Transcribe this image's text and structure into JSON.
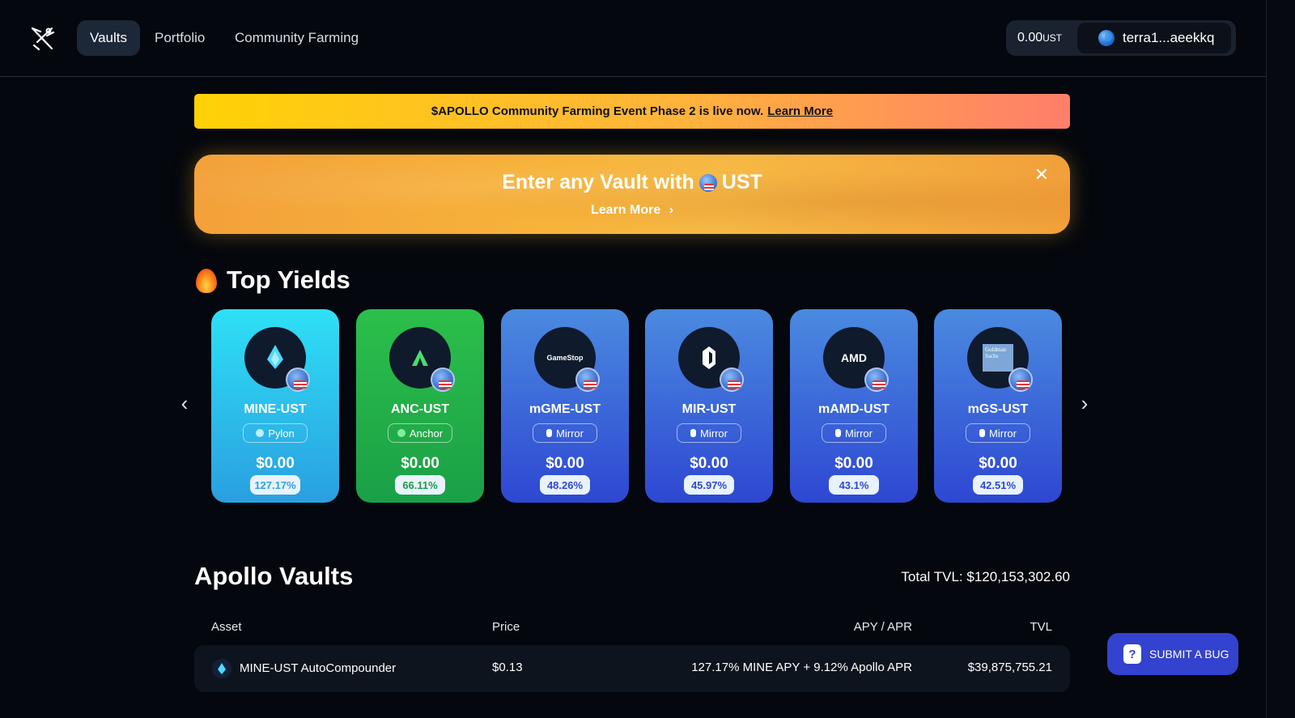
{
  "nav": {
    "items": [
      {
        "label": "Vaults"
      },
      {
        "label": "Portfolio"
      },
      {
        "label": "Community Farming"
      }
    ],
    "balance_value": "0.00",
    "balance_unit": "UST",
    "wallet_address": "terra1...aeekkq"
  },
  "notice": {
    "text": "$APOLLO Community Farming Event Phase 2 is live now.",
    "link": "Learn More"
  },
  "promo": {
    "title_before": "Enter any Vault with",
    "title_after": "UST",
    "link": "Learn More",
    "close_glyph": "✕"
  },
  "top_yields": {
    "title": "Top Yields",
    "prev_glyph": "‹",
    "next_glyph": "›",
    "cards": [
      {
        "name": "MINE-UST",
        "protocol": "Pylon",
        "price": "$0.00",
        "apy": "127.17%"
      },
      {
        "name": "ANC-UST",
        "protocol": "Anchor",
        "price": "$0.00",
        "apy": "66.11%"
      },
      {
        "name": "mGME-UST",
        "protocol": "Mirror",
        "price": "$0.00",
        "apy": "48.26%",
        "logo_text": "GameStop"
      },
      {
        "name": "MIR-UST",
        "protocol": "Mirror",
        "price": "$0.00",
        "apy": "45.97%"
      },
      {
        "name": "mAMD-UST",
        "protocol": "Mirror",
        "price": "$0.00",
        "apy": "43.1%",
        "logo_text": "AMD"
      },
      {
        "name": "mGS-UST",
        "protocol": "Mirror",
        "price": "$0.00",
        "apy": "42.51%",
        "logo_text": "Goldman Sachs"
      }
    ]
  },
  "vaults": {
    "title": "Apollo Vaults",
    "total_tvl": "Total TVL: $120,153,302.60",
    "columns": {
      "asset": "Asset",
      "price": "Price",
      "apy": "APY / APR",
      "tvl": "TVL"
    },
    "rows": [
      {
        "asset": "MINE-UST AutoCompounder",
        "price": "$0.13",
        "apy": "127.17% MINE APY + 9.12% Apollo APR",
        "tvl": "$39,875,755.21"
      }
    ]
  },
  "bug_button": {
    "label": "SUBMIT A BUG",
    "icon_glyph": "?"
  },
  "colors": {
    "background": "#04070d",
    "mine_card": "#2fc6ee",
    "anc_card": "#20b14a",
    "mirror_card": "#3a62d8",
    "bug_button": "#3342cf"
  }
}
